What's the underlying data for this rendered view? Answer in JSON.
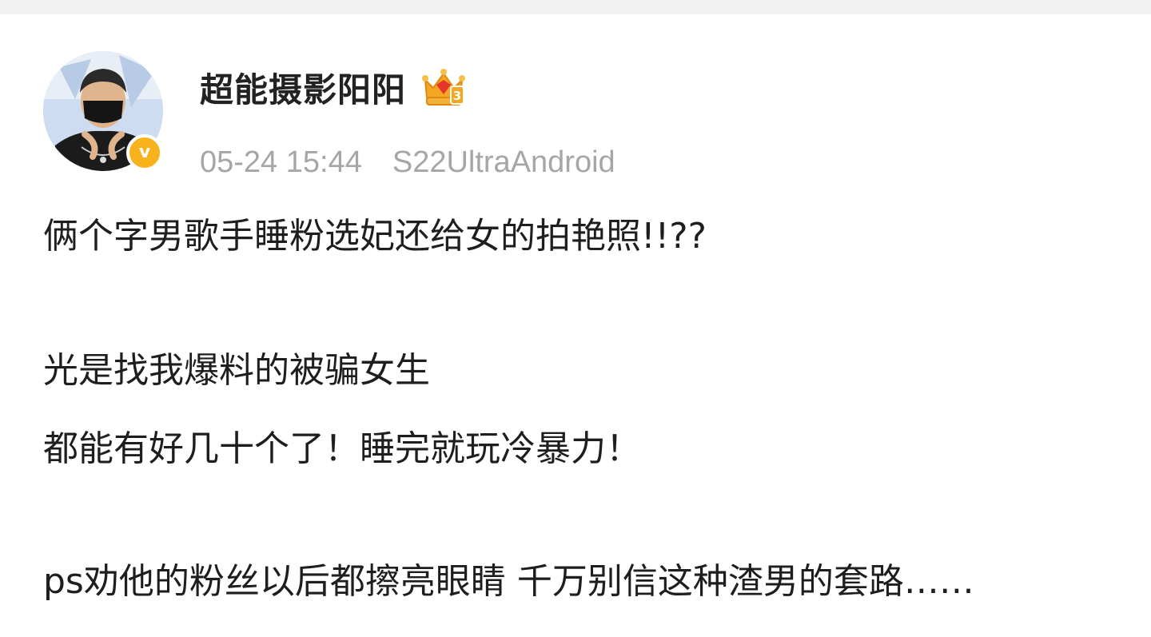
{
  "post": {
    "author": {
      "name": "超能摄影阳阳",
      "avatar_icon": "avatar-photo",
      "verified_icon": "verified-v-badge",
      "verified_label": "v",
      "vip_icon": "crown-badge",
      "vip_level": "3"
    },
    "meta": {
      "timestamp": "05-24 15:44",
      "source": "S22UltraAndroid"
    },
    "content": {
      "line1": "俩个字男歌手睡粉选妃还给女的拍艳照!!??",
      "line2": "光是找我爆料的被骗女生",
      "line3": "都能有好几十个了！睡完就玩冷暴力！",
      "line4": "ps劝他的粉丝以后都擦亮眼睛 千万别信这种渣男的套路……"
    }
  },
  "colors": {
    "background": "#ffffff",
    "top_strip": "#f2f2f2",
    "username": "#222222",
    "meta": "#a6a6a6",
    "text": "#1e1e1e",
    "verified": "#f7b21c",
    "crown": "#f5a623",
    "crown_gem": "#e8352b"
  }
}
